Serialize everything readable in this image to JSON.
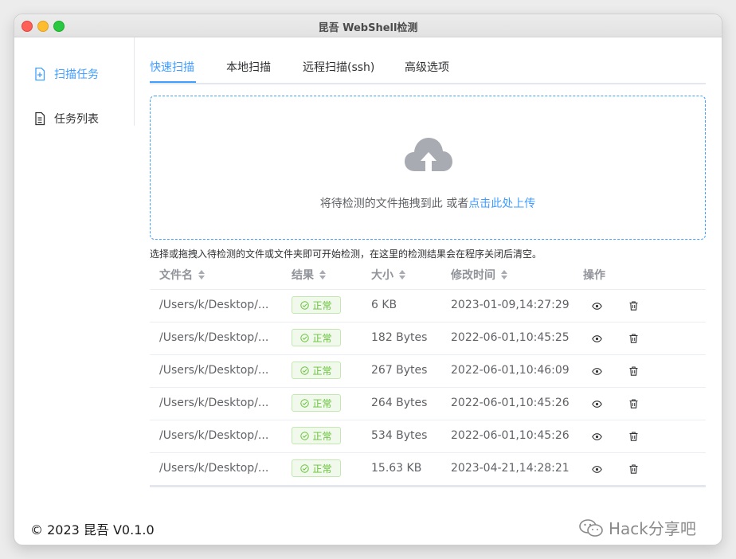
{
  "window": {
    "title": "昆吾 WebShell检测"
  },
  "sidebar": {
    "items": [
      {
        "label": "扫描任务",
        "icon": "document-add-icon",
        "active": true
      },
      {
        "label": "任务列表",
        "icon": "document-icon",
        "active": false
      }
    ]
  },
  "tabs": [
    {
      "label": "快速扫描",
      "active": true
    },
    {
      "label": "本地扫描",
      "active": false
    },
    {
      "label": "远程扫描(ssh)",
      "active": false
    },
    {
      "label": "高级选项",
      "active": false
    }
  ],
  "upload": {
    "icon": "upload-cloud-icon",
    "text": "将待检测的文件拖拽到此 或者",
    "link": "点击此处上传"
  },
  "tip": "选择或拖拽入待检测的文件或文件夹即可开始检测，在这里的检测结果会在程序关闭后清空。",
  "table": {
    "columns": {
      "name": "文件名",
      "result": "结果",
      "size": "大小",
      "mtime": "修改时间",
      "action": "操作"
    },
    "rows": [
      {
        "name": "/Users/k/Desktop/...",
        "result": "正常",
        "size": "6 KB",
        "mtime": "2023-01-09,14:27:29"
      },
      {
        "name": "/Users/k/Desktop/...",
        "result": "正常",
        "size": "182 Bytes",
        "mtime": "2022-06-01,10:45:25"
      },
      {
        "name": "/Users/k/Desktop/...",
        "result": "正常",
        "size": "267 Bytes",
        "mtime": "2022-06-01,10:46:09"
      },
      {
        "name": "/Users/k/Desktop/...",
        "result": "正常",
        "size": "264 Bytes",
        "mtime": "2022-06-01,10:45:26"
      },
      {
        "name": "/Users/k/Desktop/...",
        "result": "正常",
        "size": "534 Bytes",
        "mtime": "2022-06-01,10:45:26"
      },
      {
        "name": "/Users/k/Desktop/...",
        "result": "正常",
        "size": "15.63 KB",
        "mtime": "2023-04-21,14:28:21"
      }
    ]
  },
  "footer": {
    "text": "© 2023 昆吾 V0.1.0"
  },
  "watermark": {
    "text": "Hack分享吧"
  },
  "colors": {
    "accent": "#409eff",
    "success": "#67c23a",
    "success_bg": "#f0f9eb"
  }
}
